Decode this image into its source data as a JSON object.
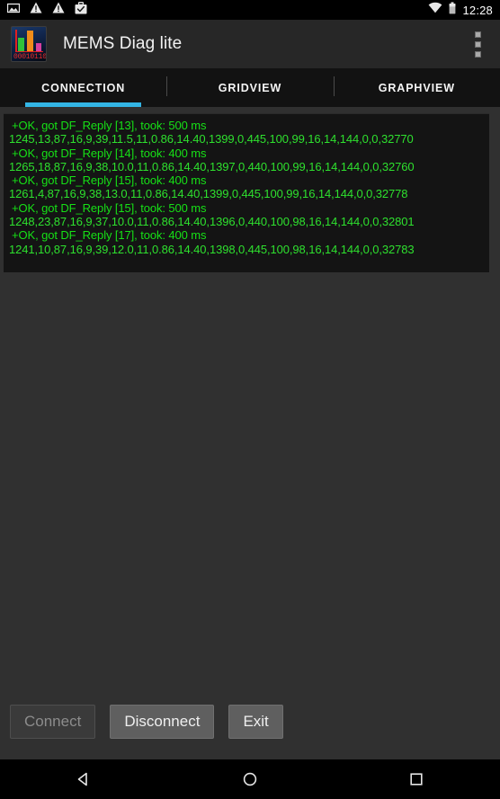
{
  "statusbar": {
    "time": "12:28",
    "left_icons": [
      {
        "name": "screenshot-icon"
      },
      {
        "name": "warning-triangle-icon"
      },
      {
        "name": "warning-triangle-icon"
      },
      {
        "name": "work-profile-briefcase-icon"
      }
    ],
    "right_icons": [
      {
        "name": "wifi-icon"
      },
      {
        "name": "battery-icon"
      }
    ]
  },
  "appbar": {
    "icon_name": "mems-diag-app-icon",
    "icon_bits": "00010110",
    "title": "MEMS Diag lite",
    "overflow_name": "overflow-menu-icon"
  },
  "tabs": [
    {
      "label": "CONNECTION",
      "active": true
    },
    {
      "label": "GRIDVIEW",
      "active": false
    },
    {
      "label": "GRAPHVIEW",
      "active": false
    }
  ],
  "log": {
    "lines": [
      {
        "type": "reply",
        "text": "+OK, got DF_Reply [13], took: 500 ms"
      },
      {
        "type": "data",
        "text": "1245,13,87,16,9,39,11.5,11,0.86,14.40,1399,0,445,100,99,16,14,144,0,0,32770"
      },
      {
        "type": "reply",
        "text": "+OK, got DF_Reply [14], took: 400 ms"
      },
      {
        "type": "data",
        "text": "1265,18,87,16,9,38,10.0,11,0.86,14.40,1397,0,440,100,99,16,14,144,0,0,32760"
      },
      {
        "type": "reply",
        "text": "+OK, got DF_Reply [15], took: 400 ms"
      },
      {
        "type": "data",
        "text": "1261,4,87,16,9,38,13.0,11,0.86,14.40,1399,0,445,100,99,16,14,144,0,0,32778"
      },
      {
        "type": "reply",
        "text": "+OK, got DF_Reply [15], took: 500 ms"
      },
      {
        "type": "data",
        "text": "1248,23,87,16,9,37,10.0,11,0.86,14.40,1396,0,440,100,98,16,14,144,0,0,32801"
      },
      {
        "type": "reply",
        "text": "+OK, got DF_Reply [17], took: 400 ms"
      },
      {
        "type": "data",
        "text": "1241,10,87,16,9,39,12.0,11,0.86,14.40,1398,0,445,100,98,16,14,144,0,0,32783"
      }
    ]
  },
  "buttons": [
    {
      "label": "Connect",
      "state": "disabled"
    },
    {
      "label": "Disconnect",
      "state": "enabled"
    },
    {
      "label": "Exit",
      "state": "enabled"
    }
  ],
  "navbar": [
    {
      "name": "nav-back-icon"
    },
    {
      "name": "nav-home-icon"
    },
    {
      "name": "nav-recents-icon"
    }
  ],
  "colors": {
    "accent": "#33b5e5",
    "log_reply": "#16e016",
    "log_data": "#2ee02e",
    "page_bg": "#303030",
    "appbar_bg": "#272727"
  }
}
